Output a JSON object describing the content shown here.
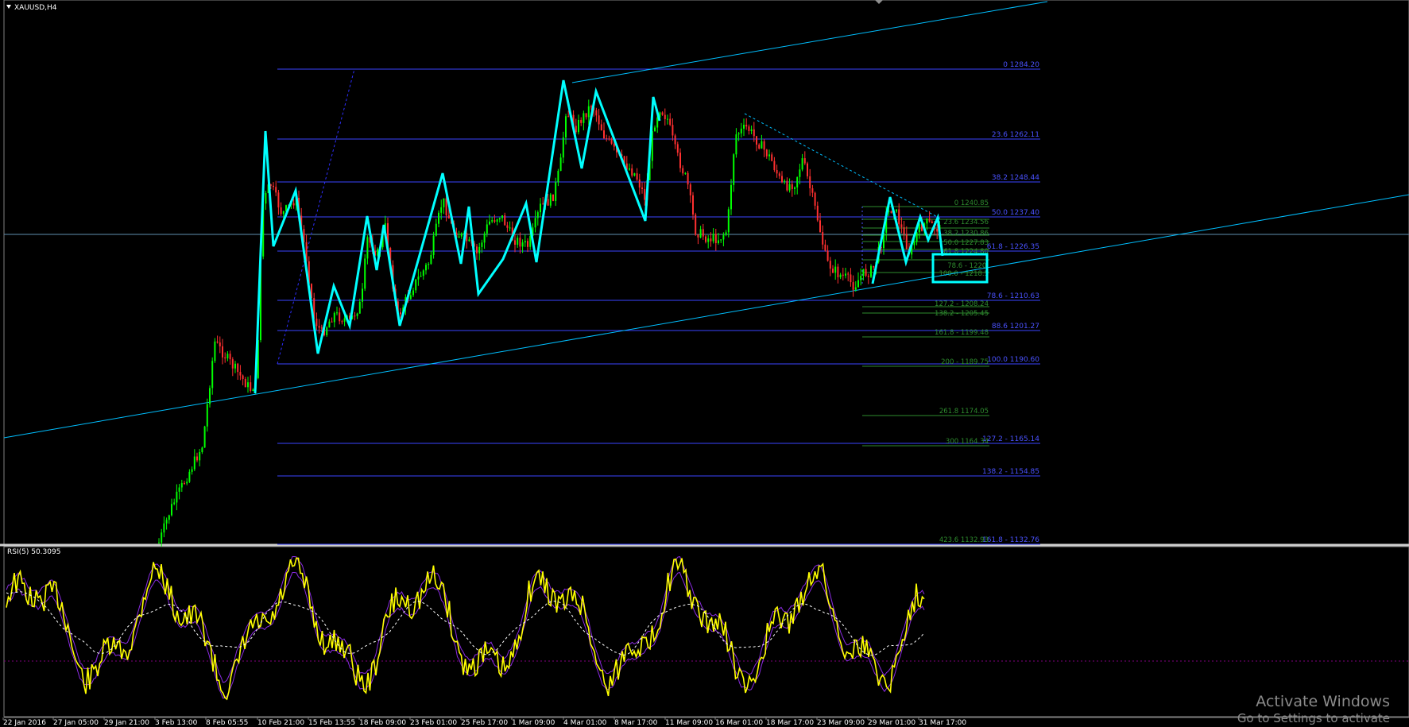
{
  "window": {
    "symbol_title": "XAUUSD,H4",
    "collapse_icon": "triangle-down-icon"
  },
  "colors": {
    "background": "#000000",
    "bull_candle": "#00ff00",
    "bear_candle": "#ff3030",
    "wave": "#00ffff",
    "trendline": "#00bfff",
    "fib_blue": "#4a52ff",
    "fib_green": "#2e8b2e",
    "rsi": "#ffff00",
    "rsi_bands": "#8a2be2",
    "level_line": "#800080",
    "axis_text": "#ffffff"
  },
  "price_fib_levels": [
    {
      "label": "0 1284.20"
    },
    {
      "label": "23.6 1262.11"
    },
    {
      "label": "38.2 1248.44"
    },
    {
      "label": "50.0 1237.40"
    },
    {
      "label": "61.8 - 1226.35"
    },
    {
      "label": "78.6 - 1210.63"
    },
    {
      "label": "88.6 1201.27"
    },
    {
      "label": "100.0 1190.60"
    },
    {
      "label": "127.2 - 1165.14"
    },
    {
      "label": "138.2 - 1154.85"
    },
    {
      "label": "161.8 - 1132.76"
    }
  ],
  "secondary_fib_levels": [
    {
      "label": "0 1240.85"
    },
    {
      "label": "23.6 1234.56"
    },
    {
      "label": "38.2 1230.86"
    },
    {
      "label": "50.0 1227.83"
    },
    {
      "label": "61.8 1224.80"
    },
    {
      "label": "78.6 - 1220."
    },
    {
      "label": "100.0 - 1218.5"
    },
    {
      "label": "127.2 - 1208.24"
    },
    {
      "label": "138.2 - 1205.45"
    },
    {
      "label": "161.8 - 1199.48"
    },
    {
      "label": "200 - 1189.75"
    },
    {
      "label": "261.8 1174.05"
    },
    {
      "label": "300 1164.34"
    },
    {
      "label": "423.6 1132.93"
    }
  ],
  "rsi_panel": {
    "label": "RSI(5) 50.3095"
  },
  "time_axis": [
    "22 Jan 2016",
    "27 Jan 05:00",
    "29 Jan 21:00",
    "3 Feb 13:00",
    "8 Feb 05:55",
    "10 Feb 21:00",
    "15 Feb 13:55",
    "18 Feb 09:00",
    "23 Feb 01:00",
    "25 Feb 17:00",
    "1 Mar 09:00",
    "4 Mar 01:00",
    "8 Mar 17:00",
    "11 Mar 09:00",
    "16 Mar 01:00",
    "18 Mar 17:00",
    "23 Mar 09:00",
    "29 Mar 01:00",
    "31 Mar 17:00"
  ],
  "windows_watermark": {
    "line1": "Activate Windows",
    "line2": "Go to Settings to activate"
  }
}
